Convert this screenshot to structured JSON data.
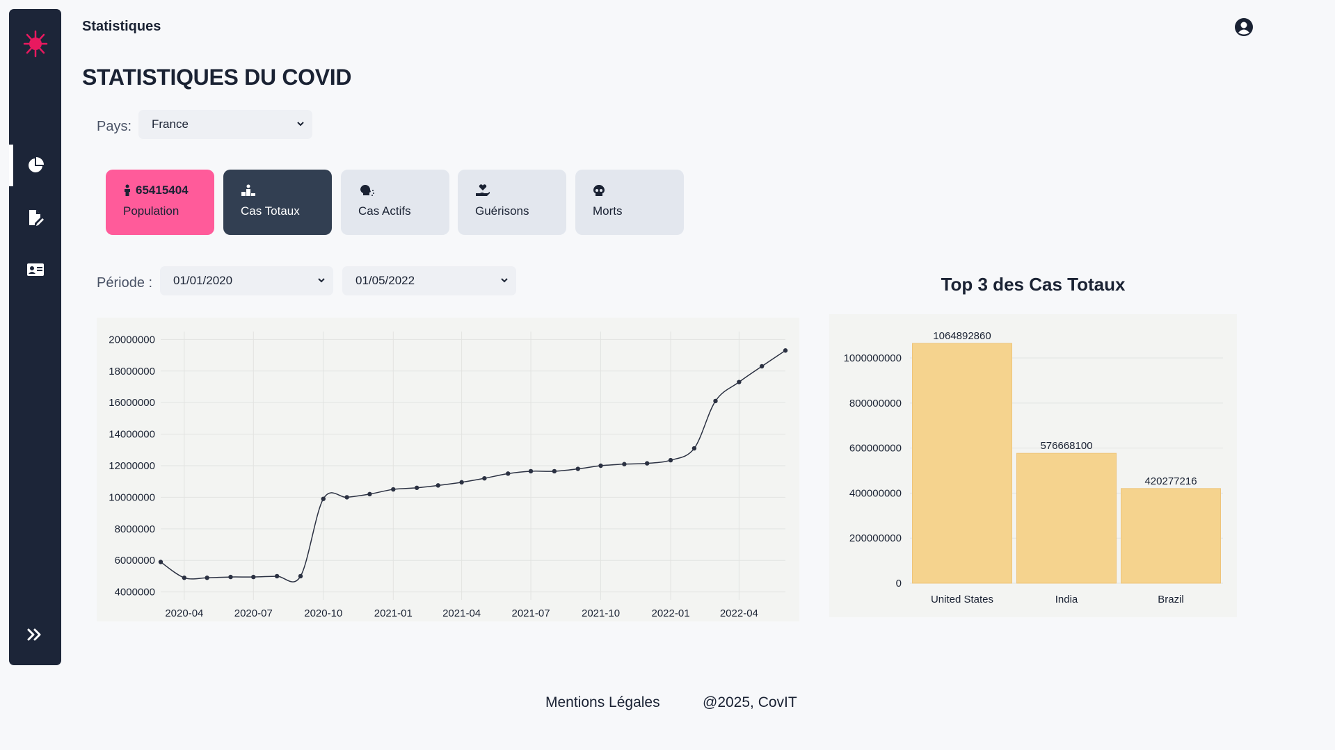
{
  "app": {
    "page_title": "Statistiques",
    "heading": "STATISTIQUES DU COVID"
  },
  "icons": {
    "logo": "virus-logo",
    "nav": [
      "chart-pie-icon",
      "file-pen-icon",
      "id-card-icon"
    ],
    "expand": "double-chevron-right-icon",
    "account": "user-circle-icon"
  },
  "colors": {
    "accent_pink": "#ff5b9a",
    "sidebar": "#1c2538",
    "active_card": "#323f52",
    "bar_fill": "#f5d38e"
  },
  "filters": {
    "country_label": "Pays:",
    "country_value": "France",
    "period_label": "Période :",
    "start_date": "01/01/2020",
    "end_date": "01/05/2022"
  },
  "cards": [
    {
      "value": "65415404",
      "label": "Population",
      "icon": "person-icon"
    },
    {
      "value": "",
      "label": "Cas Totaux",
      "icon": "podium-icon"
    },
    {
      "value": "",
      "label": "Cas Actifs",
      "icon": "head-cough-icon"
    },
    {
      "value": "",
      "label": "Guérisons",
      "icon": "hand-holding-heart-icon"
    },
    {
      "value": "",
      "label": "Morts",
      "icon": "skull-icon"
    }
  ],
  "chart_data": [
    {
      "type": "line",
      "title": "",
      "xlabel": "",
      "ylabel": "",
      "x_ticks": [
        "2020-04",
        "2020-07",
        "2020-10",
        "2021-01",
        "2021-04",
        "2021-07",
        "2021-10",
        "2022-01",
        "2022-04"
      ],
      "y_ticks": [
        "4000000",
        "6000000",
        "8000000",
        "10000000",
        "12000000",
        "14000000",
        "16000000",
        "18000000",
        "20000000"
      ],
      "ylim": [
        3500000,
        20500000
      ],
      "grid": true,
      "series": [
        {
          "values": [
            [
              "2020-03-01",
              5900000
            ],
            [
              "2020-04-01",
              4900000
            ],
            [
              "2020-05-01",
              4900000
            ],
            [
              "2020-06-01",
              4950000
            ],
            [
              "2020-07-01",
              4950000
            ],
            [
              "2020-08-01",
              5000000
            ],
            [
              "2020-09-01",
              5000000
            ],
            [
              "2020-10-01",
              9900000
            ],
            [
              "2020-11-01",
              10000000
            ],
            [
              "2020-12-01",
              10200000
            ],
            [
              "2021-01-01",
              10500000
            ],
            [
              "2021-02-01",
              10600000
            ],
            [
              "2021-03-01",
              10750000
            ],
            [
              "2021-04-01",
              10950000
            ],
            [
              "2021-05-01",
              11200000
            ],
            [
              "2021-06-01",
              11500000
            ],
            [
              "2021-07-01",
              11650000
            ],
            [
              "2021-08-01",
              11650000
            ],
            [
              "2021-09-01",
              11800000
            ],
            [
              "2021-10-01",
              12000000
            ],
            [
              "2021-11-01",
              12100000
            ],
            [
              "2021-12-01",
              12150000
            ],
            [
              "2022-01-01",
              12350000
            ],
            [
              "2022-02-01",
              13100000
            ],
            [
              "2022-03-01",
              16100000
            ],
            [
              "2022-04-01",
              17300000
            ],
            [
              "2022-05-01",
              18300000
            ],
            [
              "2022-06-01",
              19300000
            ]
          ]
        }
      ]
    },
    {
      "type": "bar",
      "title": "Top 3 des Cas Totaux",
      "xlabel": "",
      "ylabel": "",
      "categories": [
        "United States",
        "India",
        "Brazil"
      ],
      "values": [
        1064892860,
        576668100,
        420277216
      ],
      "value_labels": [
        "1064892860",
        "576668100",
        "420277216"
      ],
      "y_ticks": [
        "0",
        "200000000",
        "400000000",
        "600000000",
        "800000000",
        "1000000000"
      ],
      "ylim": [
        0,
        1064892860
      ],
      "grid": true
    }
  ],
  "footer": {
    "legal": "Mentions Légales",
    "copyright": "@2025, CovIT"
  }
}
